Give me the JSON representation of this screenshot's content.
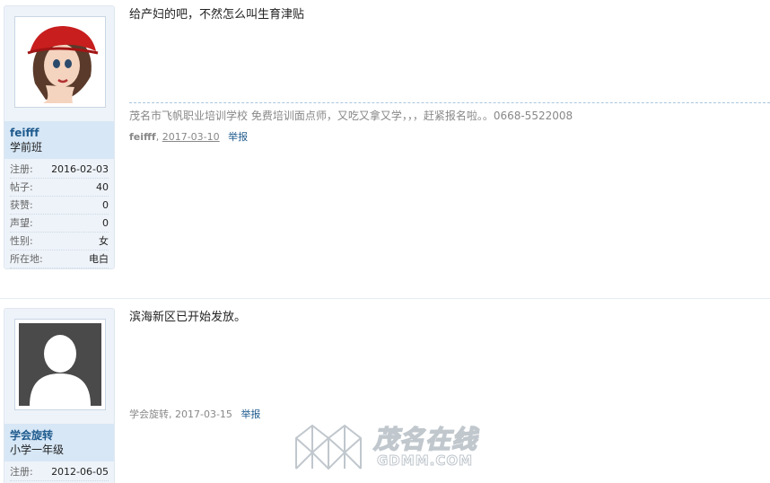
{
  "posts": [
    {
      "user": {
        "name": "feifff",
        "group": "学前班",
        "stats": [
          {
            "label": "注册:",
            "value": "2016-02-03"
          },
          {
            "label": "帖子:",
            "value": "40"
          },
          {
            "label": "获赞:",
            "value": "0"
          },
          {
            "label": "声望:",
            "value": "0"
          },
          {
            "label": "性别:",
            "value": "女"
          },
          {
            "label": "所在地:",
            "value": "电白"
          }
        ]
      },
      "message": "给产妇的吧，不然怎么叫生育津贴",
      "signature": "茂名市飞帆职业培训学校 免费培训面点师，又吃又拿又学，，，赶紧报名啦。。0668-5522008",
      "meta": {
        "author": "feifff",
        "separator": ",",
        "date": "2017-03-10",
        "report": "举报"
      }
    },
    {
      "user": {
        "name": "学会旋转",
        "group": "小学一年级",
        "stats": [
          {
            "label": "注册:",
            "value": "2012-06-05"
          }
        ]
      },
      "message": "滨海新区已开始发放。",
      "meta": {
        "author": "学会旋转",
        "separator": ",",
        "date": "2017-03-15",
        "report": "举报"
      }
    }
  ],
  "watermark": {
    "title": "茂名在线",
    "domain": "GDMM.COM"
  }
}
